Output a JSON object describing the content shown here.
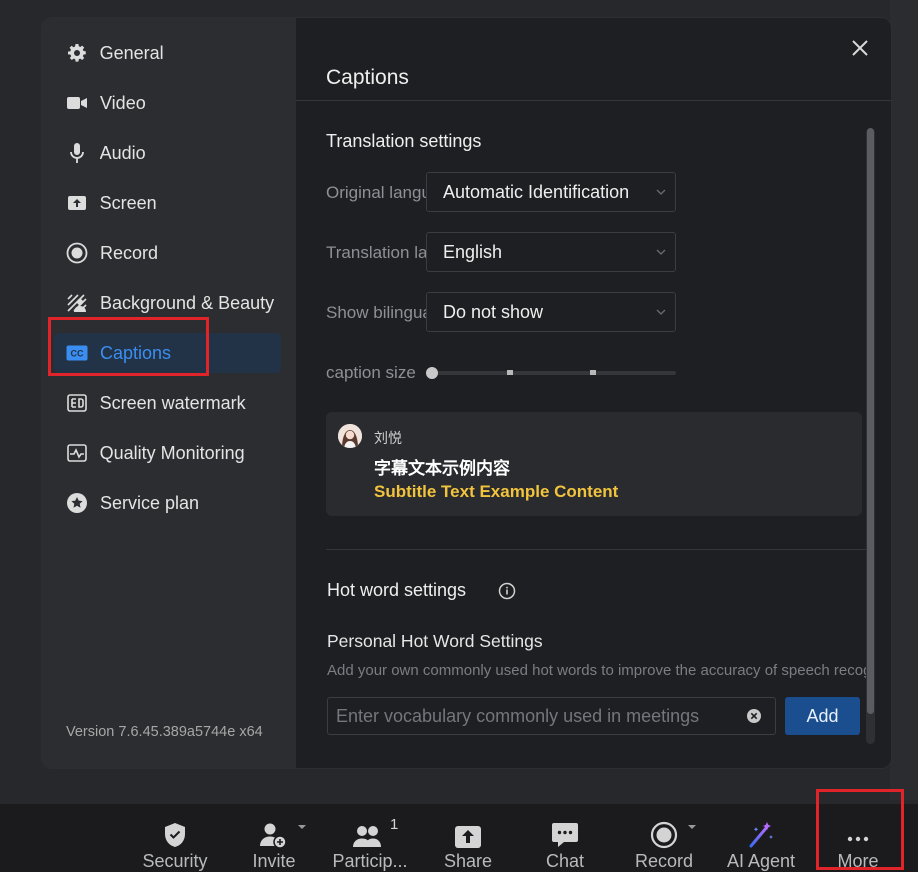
{
  "sidebar": {
    "items": [
      {
        "label": "General",
        "icon": "gear-icon"
      },
      {
        "label": "Video",
        "icon": "video-camera-icon"
      },
      {
        "label": "Audio",
        "icon": "microphone-icon"
      },
      {
        "label": "Screen",
        "icon": "screen-share-icon"
      },
      {
        "label": "Record",
        "icon": "record-icon"
      },
      {
        "label": "Background & Beauty",
        "icon": "background-beauty-icon"
      },
      {
        "label": "Captions",
        "icon": "cc-icon",
        "active": true
      },
      {
        "label": "Screen watermark",
        "icon": "watermark-icon"
      },
      {
        "label": "Quality Monitoring",
        "icon": "pulse-icon"
      },
      {
        "label": "Service plan",
        "icon": "star-icon"
      }
    ],
    "version": "Version 7.6.45.389a5744e x64"
  },
  "content": {
    "title": "Captions",
    "translation": {
      "section_title": "Translation settings",
      "original_label": "Original language",
      "original_value": "Automatic Identification",
      "translation_label": "Translation language",
      "translation_value": "English",
      "bilingual_label": "Show bilingual",
      "bilingual_value": "Do not show",
      "caption_size_label": "caption size",
      "caption_size_level": 0
    },
    "preview": {
      "speaker": "刘悦",
      "caption_original": "字幕文本示例内容",
      "caption_translation": "Subtitle Text Example Content"
    },
    "hotword": {
      "section_title": "Hot word settings",
      "personal_title": "Personal Hot Word Settings",
      "description": "Add your own commonly used hot words to improve the accuracy of speech recognition",
      "input_placeholder": "Enter vocabulary commonly used in meetings",
      "add_label": "Add"
    }
  },
  "toolbar": {
    "security": "Security",
    "invite": "Invite",
    "participants": "Particip...",
    "participant_count": "1",
    "share": "Share",
    "chat": "Chat",
    "record": "Record",
    "ai_agent": "AI Agent",
    "more": "More"
  },
  "colors": {
    "accent": "#3a8ef2",
    "add_button": "#1a4e8e",
    "caption_translation": "#f2c33d",
    "highlight_box": "#e0242a"
  }
}
